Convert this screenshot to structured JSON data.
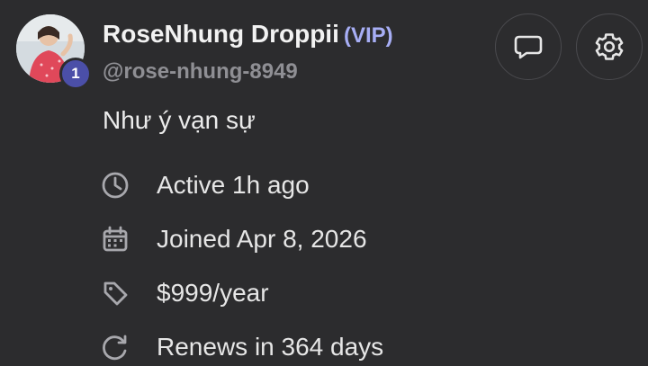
{
  "profile": {
    "display_name": "RoseNhung Droppii",
    "vip_label": "(VIP)",
    "username": "@rose-nhung-8949",
    "rank": "1",
    "bio": "Như ý vạn sự",
    "avatar_icon": "user-photo"
  },
  "actions": {
    "message_icon": "chat-bubble-icon",
    "settings_icon": "gear-icon"
  },
  "info": {
    "active": "Active 1h ago",
    "joined": "Joined Apr 8, 2026",
    "price": "$999/year",
    "renews": "Renews in 364 days"
  },
  "colors": {
    "background": "#2c2c2e",
    "vip": "#a7aef5",
    "rank_badge": "#4b4fa8",
    "muted_text": "#8f8f94"
  }
}
